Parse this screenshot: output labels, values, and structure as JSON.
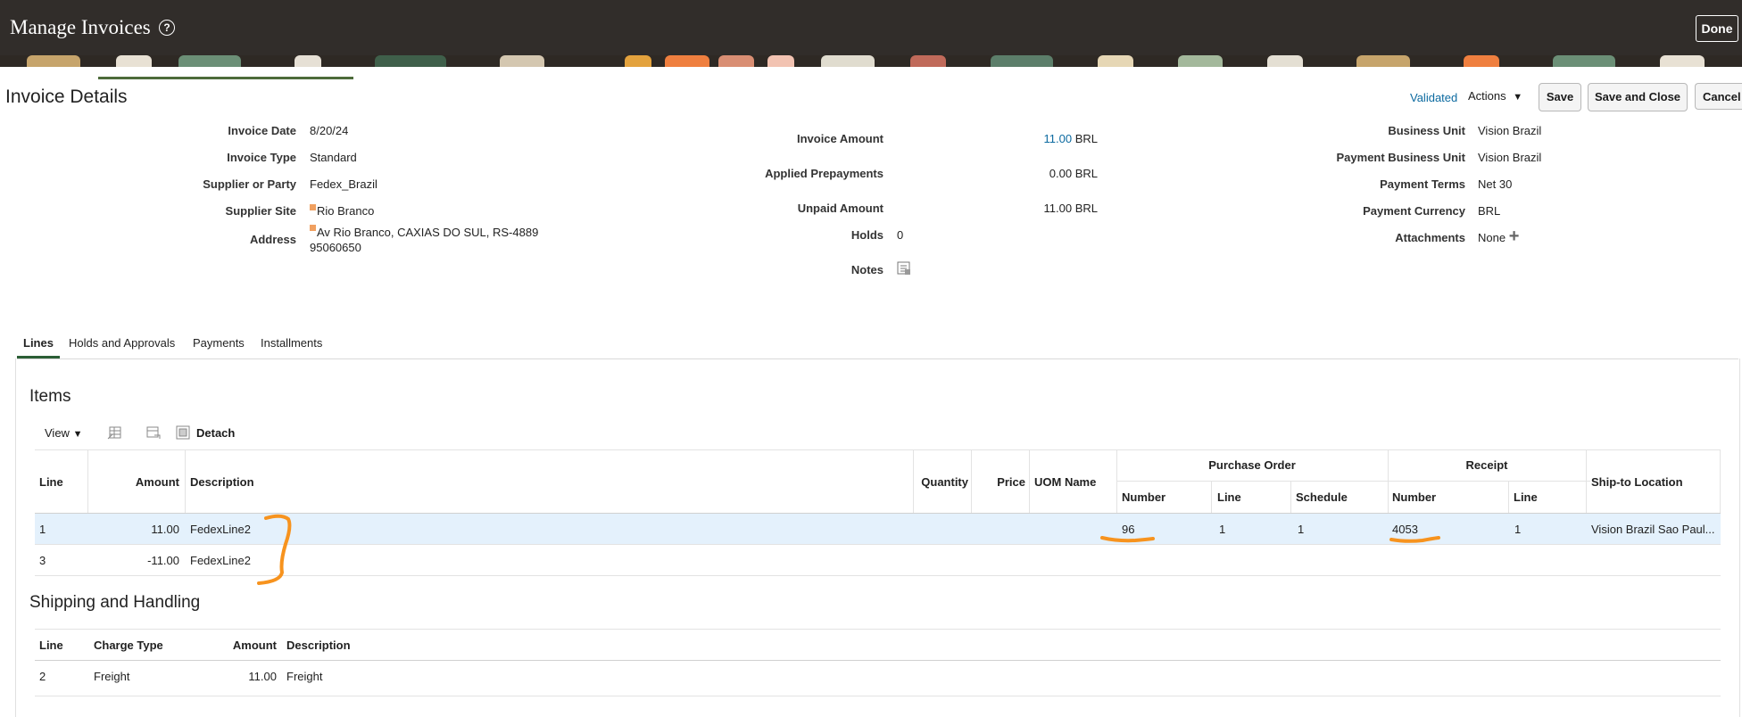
{
  "header": {
    "title": "Manage Invoices",
    "help_icon": "?",
    "done_label": "Done"
  },
  "toolbar": {
    "section_title": "Invoice Details",
    "status": "Validated",
    "actions_label": "Actions",
    "save_label": "Save",
    "save_close_label": "Save and Close",
    "cancel_label": "Cancel"
  },
  "details": {
    "invoice_date": {
      "label": "Invoice Date",
      "value": "8/20/24"
    },
    "invoice_type": {
      "label": "Invoice Type",
      "value": "Standard"
    },
    "supplier": {
      "label": "Supplier or Party",
      "value": "Fedex_Brazil"
    },
    "supplier_site": {
      "label": "Supplier Site",
      "value": "Rio Branco"
    },
    "address": {
      "label": "Address",
      "line1": "Av Rio Branco, CAXIAS DO SUL, RS-4889",
      "line2": "95060650"
    },
    "invoice_amount": {
      "label": "Invoice Amount",
      "value": "11.00",
      "currency": "BRL"
    },
    "applied_prepayments": {
      "label": "Applied Prepayments",
      "value": "0.00 BRL"
    },
    "unpaid_amount": {
      "label": "Unpaid Amount",
      "value": "11.00 BRL"
    },
    "holds": {
      "label": "Holds",
      "value": "0"
    },
    "notes": {
      "label": "Notes"
    },
    "business_unit": {
      "label": "Business Unit",
      "value": "Vision Brazil"
    },
    "payment_business_unit": {
      "label": "Payment Business Unit",
      "value": "Vision Brazil"
    },
    "payment_terms": {
      "label": "Payment Terms",
      "value": "Net 30"
    },
    "payment_currency": {
      "label": "Payment Currency",
      "value": "BRL"
    },
    "attachments": {
      "label": "Attachments",
      "value": "None"
    }
  },
  "tabs": [
    "Lines",
    "Holds and Approvals",
    "Payments",
    "Installments"
  ],
  "items": {
    "title": "Items",
    "view_label": "View",
    "detach_label": "Detach",
    "headers": {
      "line": "Line",
      "amount": "Amount",
      "description": "Description",
      "quantity": "Quantity",
      "price": "Price",
      "uom": "UOM Name",
      "po_group": "Purchase Order",
      "po_number": "Number",
      "po_line": "Line",
      "po_schedule": "Schedule",
      "receipt_group": "Receipt",
      "receipt_number": "Number",
      "receipt_line": "Line",
      "ship_to": "Ship-to Location"
    },
    "rows": [
      {
        "line": "1",
        "amount": "11.00",
        "description": "FedexLine2",
        "po_number": "96",
        "po_line": "1",
        "po_schedule": "1",
        "receipt_number": "4053",
        "receipt_line": "1",
        "ship_to": "Vision Brazil Sao Paul..."
      },
      {
        "line": "3",
        "amount": "-11.00",
        "description": "FedexLine2"
      }
    ]
  },
  "shipping": {
    "title": "Shipping and Handling",
    "headers": {
      "line": "Line",
      "charge_type": "Charge Type",
      "amount": "Amount",
      "description": "Description"
    },
    "rows": [
      {
        "line": "2",
        "charge_type": "Freight",
        "amount": "11.00",
        "description": "Freight"
      }
    ]
  },
  "colors": {
    "header_bg": "#312d2a",
    "link": "#0c6aa0",
    "selected_row": "#e4f1fc",
    "annotation": "#f7931e",
    "tab_accent": "#2b5e35"
  }
}
